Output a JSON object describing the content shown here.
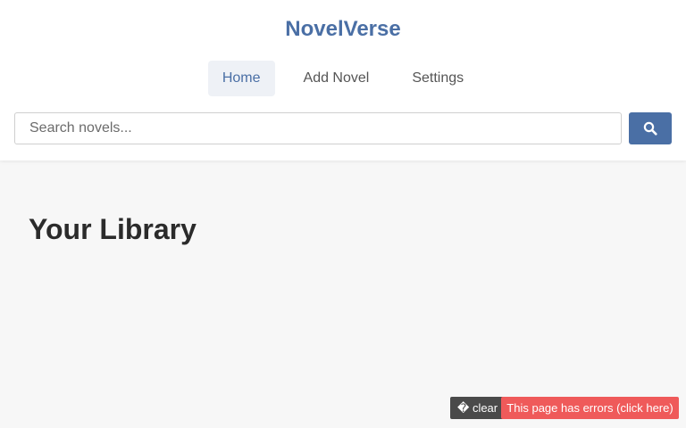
{
  "brand": {
    "title": "NovelVerse"
  },
  "nav": {
    "items": [
      {
        "label": "Home",
        "active": true
      },
      {
        "label": "Add Novel",
        "active": false
      },
      {
        "label": "Settings",
        "active": false
      }
    ]
  },
  "search": {
    "placeholder": "Search novels...",
    "value": "",
    "button_icon": "search-icon"
  },
  "main": {
    "title": "Your Library"
  },
  "debug": {
    "clear_icon": "missing-glyph",
    "clear_label": "� clear",
    "error_text": "This page has errors (click here)"
  },
  "colors": {
    "brand": "#4a6fa5",
    "page_background": "#f7f7f7",
    "header_background": "#ffffff",
    "error_background": "#ef5a5a",
    "clear_background": "#4a4a4a"
  }
}
